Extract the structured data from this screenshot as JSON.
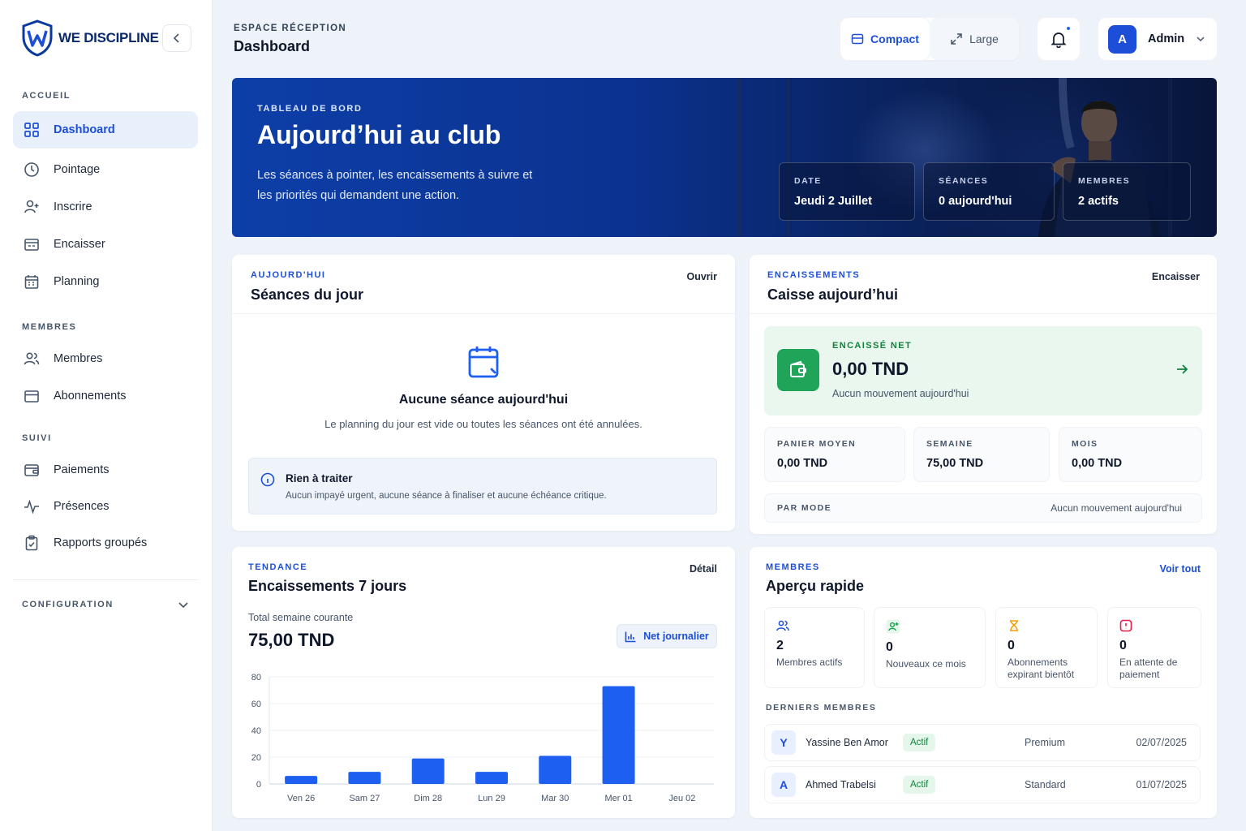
{
  "sidebar": {
    "logo_text": "WE DISCIPLINE",
    "sections": {
      "accueil": "ACCUEIL",
      "membres": "MEMBRES",
      "suivi": "SUIVI",
      "configuration": "CONFIGURATION"
    },
    "items": [
      {
        "label": "Dashboard",
        "icon": "grid-icon",
        "active": true
      },
      {
        "label": "Pointage",
        "icon": "clock-icon"
      },
      {
        "label": "Inscrire",
        "icon": "user-plus-icon"
      },
      {
        "label": "Encaisser",
        "icon": "register-icon"
      },
      {
        "label": "Planning",
        "icon": "calendar-icon"
      },
      {
        "label": "Membres",
        "icon": "users-icon"
      },
      {
        "label": "Abonnements",
        "icon": "card-icon"
      },
      {
        "label": "Paiements",
        "icon": "wallet-icon"
      },
      {
        "label": "Présences",
        "icon": "activity-icon"
      },
      {
        "label": "Rapports groupés",
        "icon": "clipboard-icon"
      }
    ]
  },
  "header": {
    "crumb": "ESPACE RÉCEPTION",
    "title": "Dashboard",
    "density_compact": "Compact",
    "density_large": "Large",
    "user_initial": "A",
    "user_name": "Admin"
  },
  "hero": {
    "kicker": "TABLEAU DE BORD",
    "title": "Aujourd’hui au club",
    "desc": "Les séances à pointer, les encaissements à suivre et les priorités qui demandent une action.",
    "stats": [
      {
        "label": "DATE",
        "value": "Jeudi 2 Juillet"
      },
      {
        "label": "SÉANCES",
        "value": "0 aujourd'hui"
      },
      {
        "label": "MEMBRES",
        "value": "2 actifs"
      }
    ]
  },
  "seances": {
    "kicker": "AUJOURD'HUI",
    "title": "Séances du jour",
    "link": "Ouvrir",
    "empty_title": "Aucune séance aujourd'hui",
    "empty_desc": "Le planning du jour est vide ou toutes les séances ont été annulées.",
    "info_title": "Rien à traiter",
    "info_desc": "Aucun impayé urgent, aucune séance à finaliser et aucune échéance critique."
  },
  "caisse": {
    "kicker": "ENCAISSEMENTS",
    "title": "Caisse aujourd’hui",
    "link": "Encaisser",
    "net_label": "ENCAISSÉ NET",
    "net_value": "0,00 TND",
    "net_desc": "Aucun mouvement aujourd'hui",
    "stats": [
      {
        "label": "PANIER MOYEN",
        "value": "0,00 TND"
      },
      {
        "label": "SEMAINE",
        "value": "75,00 TND"
      },
      {
        "label": "MOIS",
        "value": "0,00 TND"
      }
    ],
    "par_mode_label": "PAR MODE",
    "par_mode_value": "Aucun mouvement aujourd'hui"
  },
  "tendance": {
    "kicker": "TENDANCE",
    "title": "Encaissements 7 jours",
    "link": "Détail",
    "total_label": "Total semaine courante",
    "total_value": "75,00 TND",
    "button": "Net journalier"
  },
  "chart_data": {
    "type": "bar",
    "categories": [
      "Ven 26",
      "Sam 27",
      "Dim 28",
      "Lun 29",
      "Mar 30",
      "Mer 01",
      "Jeu 02"
    ],
    "values": [
      6,
      9,
      19,
      9,
      21,
      73,
      0
    ],
    "ylim": [
      0,
      80
    ],
    "yticks": [
      0,
      20,
      40,
      60,
      80
    ],
    "color": "#1d5ff0",
    "grid": true
  },
  "apercu": {
    "kicker": "MEMBRES",
    "title": "Aperçu rapide",
    "link": "Voir tout",
    "stats": [
      {
        "value": "2",
        "label": "Membres actifs",
        "icon": "users-icon",
        "color": "#1d4ed8"
      },
      {
        "value": "0",
        "label": "Nouveaux ce mois",
        "icon": "user-plus-icon",
        "color": "#16a34a"
      },
      {
        "value": "0",
        "label": "Abonnements expirant bientôt",
        "icon": "hourglass-icon",
        "color": "#f59e0b"
      },
      {
        "value": "0",
        "label": "En attente de paiement",
        "icon": "alert-icon",
        "color": "#e11d48"
      }
    ],
    "recent_title": "DERNIERS MEMBRES",
    "recent": [
      {
        "initial": "Y",
        "name": "Yassine Ben Amor",
        "status": "Actif",
        "plan": "Premium",
        "date": "02/07/2025"
      },
      {
        "initial": "A",
        "name": "Ahmed Trabelsi",
        "status": "Actif",
        "plan": "Standard",
        "date": "01/07/2025"
      }
    ]
  }
}
